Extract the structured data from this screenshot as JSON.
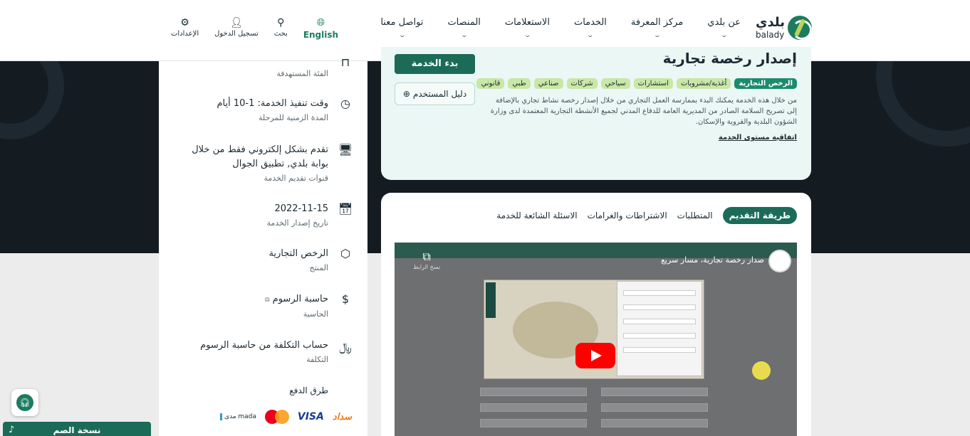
{
  "header": {
    "logo_ar": "بلدي",
    "logo_en": "balady",
    "nav": [
      {
        "label": "عن بلدي"
      },
      {
        "label": "مركز المعرفة"
      },
      {
        "label": "الخدمات"
      },
      {
        "label": "الاستعلامات"
      },
      {
        "label": "المنصات"
      },
      {
        "label": "تواصل معنا"
      }
    ],
    "tools": {
      "language": "English",
      "search": "بحث",
      "login": "تسجيل الدخول",
      "settings": "الإعدادات"
    }
  },
  "info": {
    "target_label": "الفئة المستهدفة",
    "duration_value": "وقت تنفيذ الخدمة: 1-10 أيام",
    "duration_label": "المدة الزمنية للمرحلة",
    "channels_value": "تقدم بشكل إلكتروني فقط من خلال بوابة بلدي, تطبيق الجوال",
    "channels_label": "قنوات تقديم الخدمة",
    "date_value": "2022-11-15",
    "date_label": "تاريخ إصدار الخدمة",
    "product_value": "الرخص التجارية",
    "product_label": "المنتج",
    "calculator_value": "حاسبة الرسوم",
    "calculator_label": "الحاسبة",
    "cost_value": "حساب التكلفة من حاسبة الرسوم",
    "cost_label": "التكلفة",
    "payment_title": "طرق الدفع",
    "payment": {
      "sadad": "سداد",
      "visa": "VISA",
      "mada": "مدى mada"
    }
  },
  "service": {
    "title": "إصدار رخصة تجارية",
    "start_button": "بدء الخدمة",
    "guide_button": "دليل المستخدم",
    "tags": [
      "الرخص التجارية",
      "أغذية/مشروبات",
      "استشارات",
      "سياحي",
      "شركات",
      "صناعي",
      "طبي",
      "قانوني"
    ],
    "description": "من خلال هذه الخدمة يمكنك البدء بممارسة العمل التجاري من خلال إصدار رخصة نشاط تجاري بالإضافة إلى تصريح السلامة الصادر من المديرية العامة للدفاع المدني لجميع الأنشطة التجارية المعتمدة لدى وزارة الشؤون البلدية والقروية والإسكان.",
    "sla_link": "اتفاقية مستوى الخدمة"
  },
  "tabs": [
    {
      "label": "طريقة التقديم",
      "active": true
    },
    {
      "label": "المتطلبات",
      "active": false
    },
    {
      "label": "الاشتراطات والغرامات",
      "active": false
    },
    {
      "label": "الاسئلة الشائعة للخدمة",
      "active": false
    }
  ],
  "video": {
    "title": "صدار رخصة تجارية، مسار سريع",
    "copy_label": "نسخ الرابط"
  },
  "accessibility": {
    "blind_version": "نسخة الصم"
  },
  "colors": {
    "brand_green": "#1b6b58",
    "tag_green": "#c9e7a6",
    "dark_band": "#141c22",
    "card_tint": "#eaf7f4"
  }
}
